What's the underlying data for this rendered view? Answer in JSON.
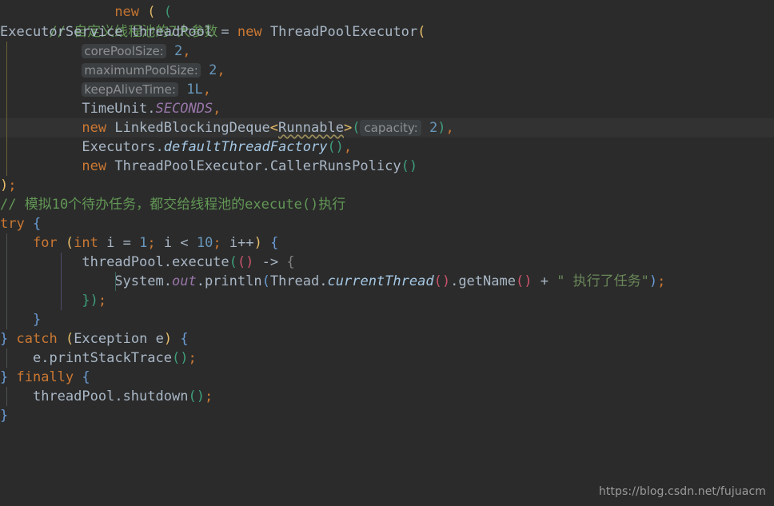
{
  "editor": {
    "language": "java",
    "theme": "darcula",
    "background_color": "#2b2b2b",
    "caret_row_color": "#323232",
    "default_text_color": "#a9b7c6",
    "comment_color": "#629755",
    "keyword_color": "#cc7832",
    "number_color": "#6897bb",
    "string_color": "#6a8759",
    "static_field_color": "#9876aa",
    "static_method_color": "#a5c8e4",
    "hint_badge_bg": "#3c3f41",
    "hint_badge_fg": "#8d8f91"
  },
  "code": {
    "comment_1": "// 自定义线程池的7大参数",
    "line_declaration": {
      "type": "ExecutorService",
      "var": "threadPool",
      "assign": "=",
      "new": "new",
      "ctor": "ThreadPoolExecutor",
      "open_paren": "("
    },
    "args": [
      {
        "hint": "corePoolSize:",
        "value": "2",
        "comma": ","
      },
      {
        "hint": "maximumPoolSize:",
        "value": "2",
        "comma": ","
      },
      {
        "hint": "keepAliveTime:",
        "value": "1L",
        "comma": ","
      }
    ],
    "line_timeunit": {
      "class": "TimeUnit",
      "dot": ".",
      "field": "SECONDS",
      "comma": ","
    },
    "line_queue": {
      "new": "new",
      "class": "LinkedBlockingDeque",
      "lt": "<",
      "generic": "Runnable",
      "gt": ">",
      "open_paren": "(",
      "hint": "capacity:",
      "value": "2",
      "close_paren": ")",
      "comma": ",",
      "highlighted": true,
      "generic_has_warning_squiggle": true
    },
    "line_factory": {
      "class": "Executors",
      "dot": ".",
      "method": "defaultThreadFactory",
      "parens": "()",
      "comma": ","
    },
    "line_policy": {
      "new": "new",
      "class": "ThreadPoolExecutor",
      "dot": ".",
      "inner": "CallerRunsPolicy",
      "parens": "()"
    },
    "line_close_ctor": {
      "close_paren": ")",
      "semi": ";"
    },
    "comment_2": "// 模拟10个待办任务，都交给线程池的execute()执行",
    "line_try": {
      "kw": "try",
      "brace": "{"
    },
    "line_for": {
      "kw": "for",
      "open_paren": "(",
      "type": "int",
      "var": "i",
      "eq": "=",
      "start": "1",
      "semi1": ";",
      "cond_var": "i",
      "lt": "<",
      "limit": "10",
      "semi2": ";",
      "inc": "i++",
      "close_paren": ")",
      "brace": "{"
    },
    "line_execute": {
      "obj": "threadPool",
      "dot": ".",
      "method": "execute",
      "open_paren": "(",
      "lambda_params": "()",
      "arrow": "->",
      "brace": "{"
    },
    "line_println": {
      "system": "System",
      "dot1": ".",
      "out": "out",
      "dot2": ".",
      "println": "println",
      "open_paren": "(",
      "thread": "Thread",
      "dot3": ".",
      "current": "currentThread",
      "parens1": "()",
      "dot4": ".",
      "getname": "getName",
      "parens2": "()",
      "plus": "+",
      "string": "\" 执行了任务\"",
      "close_paren": ")",
      "semi": ";"
    },
    "line_lambda_close": {
      "brace": "}",
      "paren": ")",
      "semi": ";"
    },
    "line_for_close": {
      "brace": "}"
    },
    "line_catch": {
      "brace_close": "}",
      "kw": "catch",
      "open_paren": "(",
      "type": "Exception",
      "var": "e",
      "close_paren": ")",
      "brace": "{"
    },
    "line_printstack": {
      "obj": "e",
      "dot": ".",
      "method": "printStackTrace",
      "parens": "()",
      "semi": ";"
    },
    "line_finally": {
      "brace_close": "}",
      "kw": "finally",
      "brace": "{"
    },
    "line_shutdown": {
      "obj": "threadPool",
      "dot": ".",
      "method": "shutdown",
      "parens": "()",
      "semi": ";"
    },
    "line_end": {
      "brace": "}"
    }
  },
  "watermark": {
    "text": "https://blog.csdn.net/fujuacm"
  }
}
